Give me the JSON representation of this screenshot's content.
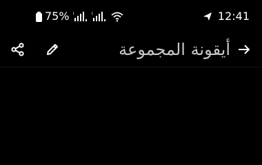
{
  "status_bar": {
    "battery_percent": "75%",
    "time": "12:41",
    "icons": [
      "battery-icon",
      "signal-icon",
      "signal-icon",
      "wifi-icon",
      "send-icon"
    ]
  },
  "app_bar": {
    "title": "أيقونة المجموعة",
    "actions": [
      "share-icon",
      "edit-icon"
    ],
    "navigation": "arrow-right-icon"
  },
  "colors": {
    "background": "#000000",
    "title_text": "#c8c8c8",
    "icon": "#ffffff"
  }
}
